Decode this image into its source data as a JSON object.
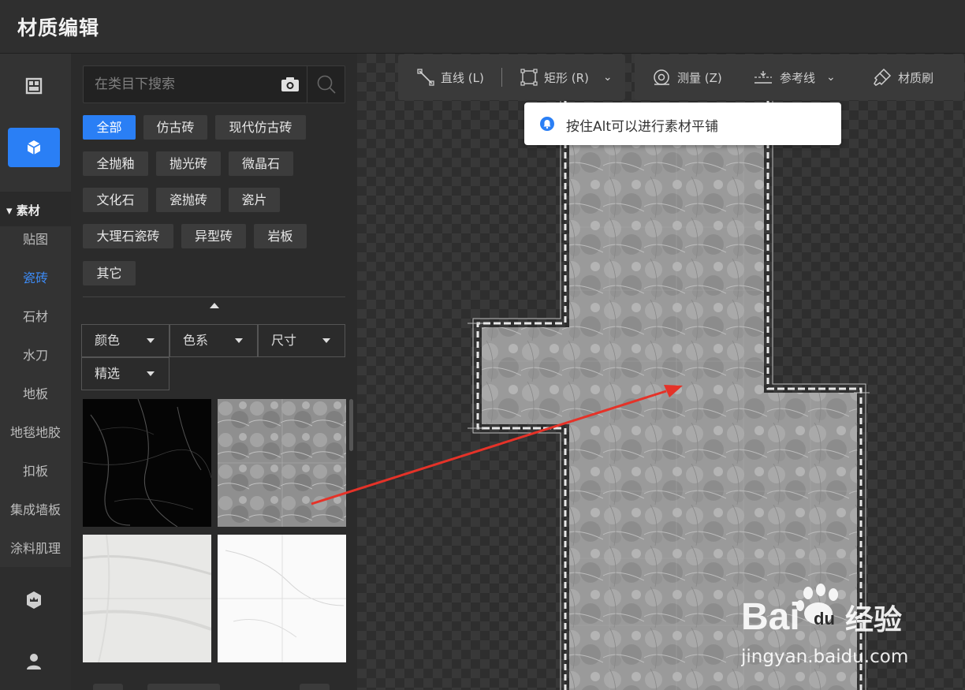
{
  "app": {
    "title": "材质编辑"
  },
  "rail": {
    "section_label": "素材",
    "items": [
      {
        "label": "贴图"
      },
      {
        "label": "瓷砖"
      },
      {
        "label": "石材"
      },
      {
        "label": "水刀"
      },
      {
        "label": "地板"
      },
      {
        "label": "地毯地胶"
      },
      {
        "label": "扣板"
      },
      {
        "label": "集成墙板"
      },
      {
        "label": "涂料肌理"
      }
    ],
    "active_item": "瓷砖",
    "icons": [
      "layout-icon",
      "cube-icon",
      "badge-icon",
      "user-icon"
    ]
  },
  "search": {
    "placeholder": "在类目下搜索"
  },
  "categories": [
    {
      "label": "全部",
      "active": true
    },
    {
      "label": "仿古砖"
    },
    {
      "label": "现代仿古砖"
    },
    {
      "label": "全抛釉"
    },
    {
      "label": "抛光砖"
    },
    {
      "label": "微晶石"
    },
    {
      "label": "文化石"
    },
    {
      "label": "瓷抛砖"
    },
    {
      "label": "瓷片"
    },
    {
      "label": "大理石瓷砖"
    },
    {
      "label": "异型砖"
    },
    {
      "label": "岩板"
    },
    {
      "label": "其它"
    }
  ],
  "filters": [
    {
      "label": "颜色"
    },
    {
      "label": "色系"
    },
    {
      "label": "尺寸"
    },
    {
      "label": "精选"
    }
  ],
  "materials": [
    {
      "name": "black-marble-thumbnail"
    },
    {
      "name": "grey-marble-thumbnail"
    },
    {
      "name": "white-marble-thumbnail"
    },
    {
      "name": "white-tile-thumbnail"
    }
  ],
  "toolbar": {
    "line": "直线 (L)",
    "rect": "矩形 (R)",
    "measure": "测量 (Z)",
    "guide": "参考线",
    "brush": "材质刷"
  },
  "tooltip": {
    "message": "按住Alt可以进行素材平铺"
  },
  "watermark": {
    "brand": "Bai",
    "brand_suffix": "经验",
    "du": "du",
    "url": "jingyan.baidu.com"
  },
  "colors": {
    "accent": "#2a7ff5",
    "annotation_arrow": "#e53228"
  }
}
